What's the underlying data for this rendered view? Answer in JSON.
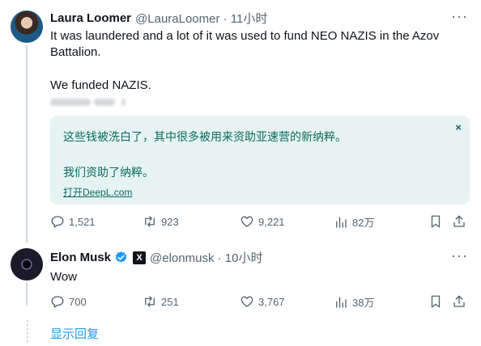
{
  "tweet1": {
    "name": "Laura Loomer",
    "handle": "@LauraLoomer · 11小时",
    "text1": "It was laundered and a lot of it was used to fund NEO NAZIS in the Azov Battalion.",
    "text2": "We funded NAZIS.",
    "translation": {
      "line1": "这些钱被洗白了，其中很多被用来资助亚速营的新纳粹。",
      "line2": "我们资助了纳粹。",
      "link": "打开DeepL.com",
      "close": "×"
    },
    "actions": {
      "replies": "1,521",
      "retweets": "923",
      "likes": "9,221",
      "views": "82万"
    }
  },
  "tweet2": {
    "name": "Elon Musk",
    "handle": "@elonmusk · 10小时",
    "badge": "X",
    "text": "Wow",
    "actions": {
      "replies": "700",
      "retweets": "251",
      "likes": "3,767",
      "views": "38万"
    }
  },
  "show_replies": "显示回复",
  "more": "···",
  "colors": {
    "verified": "#1d9bf0",
    "link": "#1d9bf0",
    "translate_bg": "#e6f3f2",
    "translate_text": "#0d6b60",
    "muted": "#536471"
  }
}
